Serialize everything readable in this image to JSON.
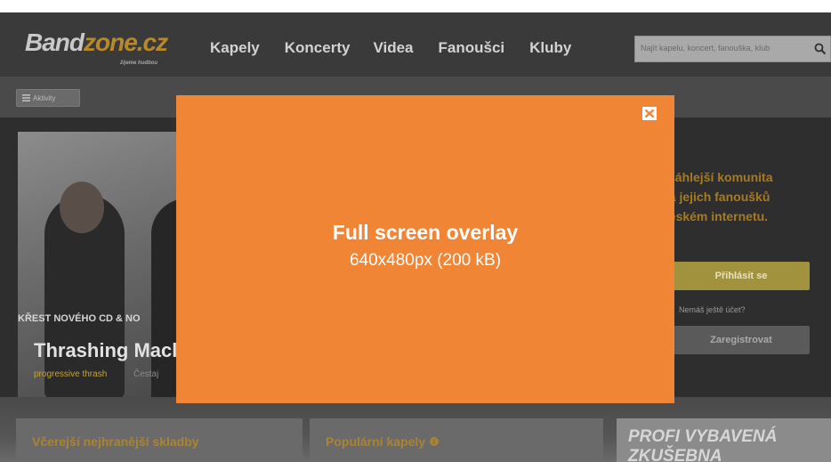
{
  "header": {
    "logo_main": "Band",
    "logo_zone": "zone.cz",
    "logo_tagline": "žijeme hudbou",
    "nav": [
      "Kapely",
      "Koncerty",
      "Videa",
      "Fanoušci",
      "Kluby"
    ],
    "search_placeholder": "Najít kapelu, koncert, fanouška, klub",
    "search_icon": "search-icon"
  },
  "subbar": {
    "aktivity_label": "Aktivity"
  },
  "hero": {
    "tag": "KŘEST NOVÉHO CD & NO",
    "title": "Thrashing Macl",
    "genre": "progressive thrash",
    "sub": "Čestaj"
  },
  "side": {
    "promo": "zsáhlejší komunita\nl a jejich fanoušků\nčeském internetu.",
    "login_label": "Přihlásit se",
    "no_account": "Nemáš ještě účet?",
    "register_label": "Zaregistrovat"
  },
  "lower": {
    "title1": "Včerejší nejhranější skladby",
    "title2": "Populární kapely",
    "profi": "PROFI VYBAVENÁ\nZKUŠEBNA"
  },
  "overlay": {
    "title": "Full screen overlay",
    "subtitle": "640x480px (200 kB)",
    "color": "#f08536"
  }
}
